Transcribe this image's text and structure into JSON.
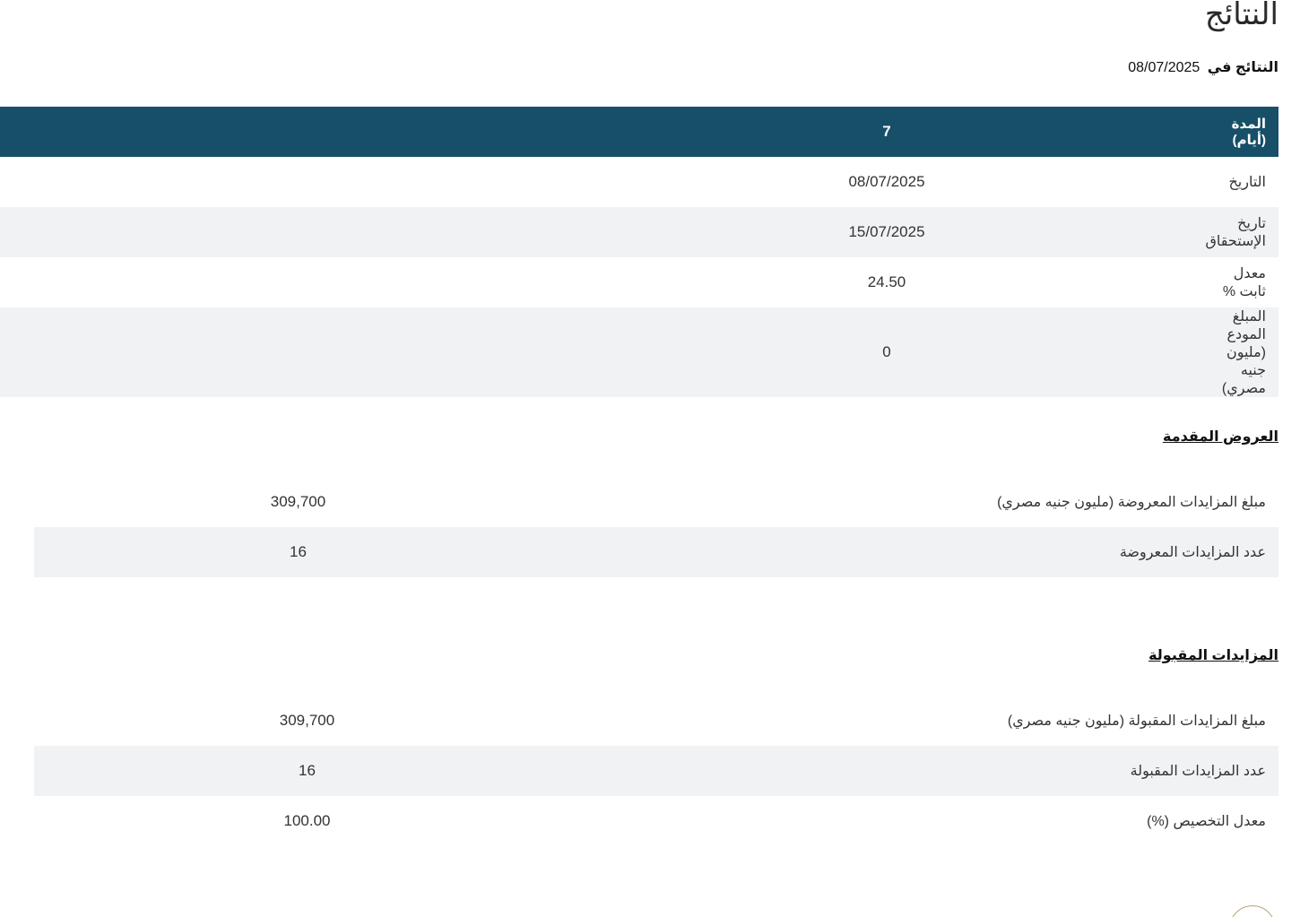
{
  "page": {
    "title": "النتائج",
    "subtitle_label": "النتائج في",
    "subtitle_date": "08/07/2025"
  },
  "summary": {
    "header": {
      "label": "المدة (أيام)",
      "value": "7"
    },
    "rows": [
      {
        "label": "التاريخ",
        "value": "08/07/2025"
      },
      {
        "label": "تاريخ الإستحقاق",
        "value": "15/07/2025"
      },
      {
        "label": "معدل ثابت %",
        "value": "24.50"
      },
      {
        "label": "المبلغ المودع (مليون جنيه مصري)",
        "value": "0"
      }
    ]
  },
  "offers": {
    "heading": "العروض المقدمة",
    "rows": [
      {
        "label": "مبلغ المزايدات المعروضة (مليون جنيه مصري)",
        "value": "309,700"
      },
      {
        "label": "عدد المزايدات المعروضة",
        "value": "16"
      }
    ]
  },
  "accepted": {
    "heading": "المزايدات المقبولة",
    "rows": [
      {
        "label": "مبلغ المزايدات المقبولة (مليون جنيه مصري)",
        "value": "309,700"
      },
      {
        "label": "عدد المزايدات المقبولة",
        "value": "16"
      },
      {
        "label": "معدل التخصيص (%)",
        "value": "100.00"
      }
    ]
  },
  "colors": {
    "header_bg": "#174f68",
    "alt_row_bg": "#f1f2f4",
    "accent_circle": "#b9a57a"
  }
}
